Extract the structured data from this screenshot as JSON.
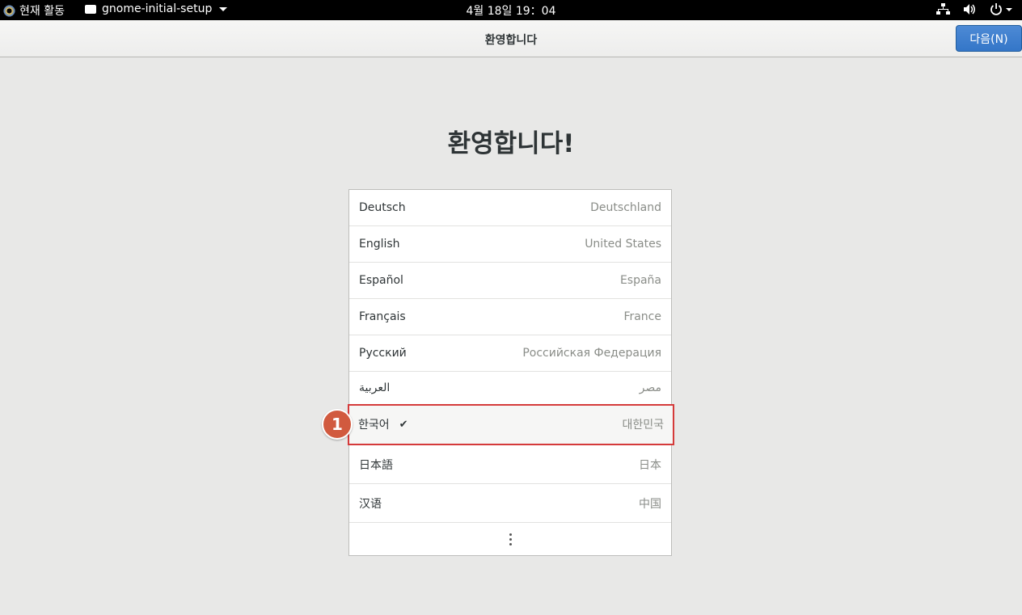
{
  "topbar": {
    "activities": "현재 활동",
    "app_menu": "gnome-initial-setup",
    "clock": "4월 18일 19：04",
    "tray_icons": [
      "network-icon",
      "volume-icon",
      "power-icon"
    ]
  },
  "header": {
    "title": "환영합니다",
    "next_button": "다음(N)"
  },
  "main": {
    "heading": "환영합니다!",
    "languages": [
      {
        "lang": "Deutsch",
        "region": "Deutschland"
      },
      {
        "lang": "English",
        "region": "United States"
      },
      {
        "lang": "Español",
        "region": "España"
      },
      {
        "lang": "Français",
        "region": "France"
      },
      {
        "lang": "Русский",
        "region": "Российская Федерация"
      },
      {
        "lang": "العربية",
        "region": "مصر"
      },
      {
        "lang": "한국어",
        "region": "대한민국",
        "selected": true
      },
      {
        "lang": "日本語",
        "region": "日本"
      },
      {
        "lang": "汉语",
        "region": "中国"
      }
    ],
    "check_mark": "✔",
    "annotation_badge": "1"
  },
  "colors": {
    "accent": "#3476c8",
    "highlight": "#d53a3a",
    "badge": "#d15a3f"
  }
}
